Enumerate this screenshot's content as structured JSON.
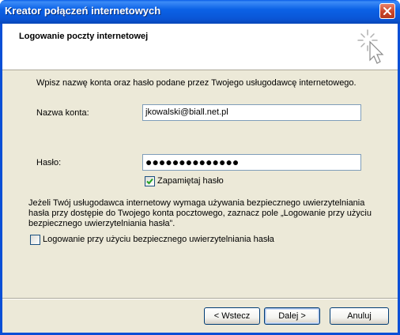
{
  "window": {
    "title": "Kreator połączeń internetowych"
  },
  "header": {
    "title": "Logowanie poczty internetowej"
  },
  "body": {
    "intro": "Wpisz nazwę konta oraz hasło podane przez Twojego usługodawcę internetowego.",
    "account_label": "Nazwa konta:",
    "account_value": "jkowalski@biall.net.pl",
    "password_label": "Hasło:",
    "password_value": "●●●●●●●●●●●●●●",
    "remember_label": "Zapamiętaj hasło",
    "remember_checked": true,
    "spa_info": "Jeżeli Twój usługodawca internetowy wymaga używania bezpiecznego uwierzytelniania hasła przy dostępie do Twojego konta pocztowego, zaznacz pole „Logowanie przy użyciu bezpiecznego uwierzytelniania hasła”.",
    "spa_label": "Logowanie przy użyciu bezpiecznego uwierzytelniania hasła",
    "spa_checked": false
  },
  "buttons": {
    "back": "< Wstecz",
    "next": "Dalej >",
    "cancel": "Anuluj"
  },
  "icons": {
    "close": "close-icon",
    "wizard": "wizard-cursor-icon",
    "check": "checkmark-icon"
  }
}
